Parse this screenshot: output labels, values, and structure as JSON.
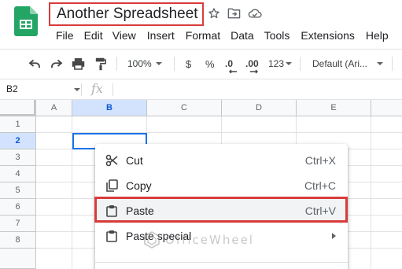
{
  "app": {
    "doc_title": "Another Spreadsheet"
  },
  "menu": [
    "File",
    "Edit",
    "View",
    "Insert",
    "Format",
    "Data",
    "Tools",
    "Extensions",
    "Help"
  ],
  "toolbar": {
    "zoom": "100%",
    "currency": "$",
    "percent": "%",
    "decrease_decimal": ".0",
    "increase_decimal": ".00",
    "number_format": "123",
    "font": "Default (Ari..."
  },
  "formula_bar": {
    "cell_ref": "B2",
    "fx": "fx"
  },
  "grid": {
    "columns": [
      "A",
      "B",
      "C",
      "D",
      "E"
    ],
    "rows": [
      "1",
      "2",
      "3",
      "4",
      "5",
      "6",
      "7",
      "8"
    ],
    "selected_cell": "B2"
  },
  "context_menu": {
    "items": [
      {
        "label": "Cut",
        "shortcut": "Ctrl+X",
        "icon": "scissors-icon"
      },
      {
        "label": "Copy",
        "shortcut": "Ctrl+C",
        "icon": "copy-icon"
      },
      {
        "label": "Paste",
        "shortcut": "Ctrl+V",
        "icon": "clipboard-icon"
      },
      {
        "label": "Paste special",
        "shortcut": "",
        "icon": "clipboard-icon"
      }
    ]
  },
  "watermark": {
    "text": "OfficeWheel"
  },
  "colors": {
    "highlight": "#d93b3b",
    "selection": "#1a73e8",
    "sheets_green": "#23a566"
  }
}
